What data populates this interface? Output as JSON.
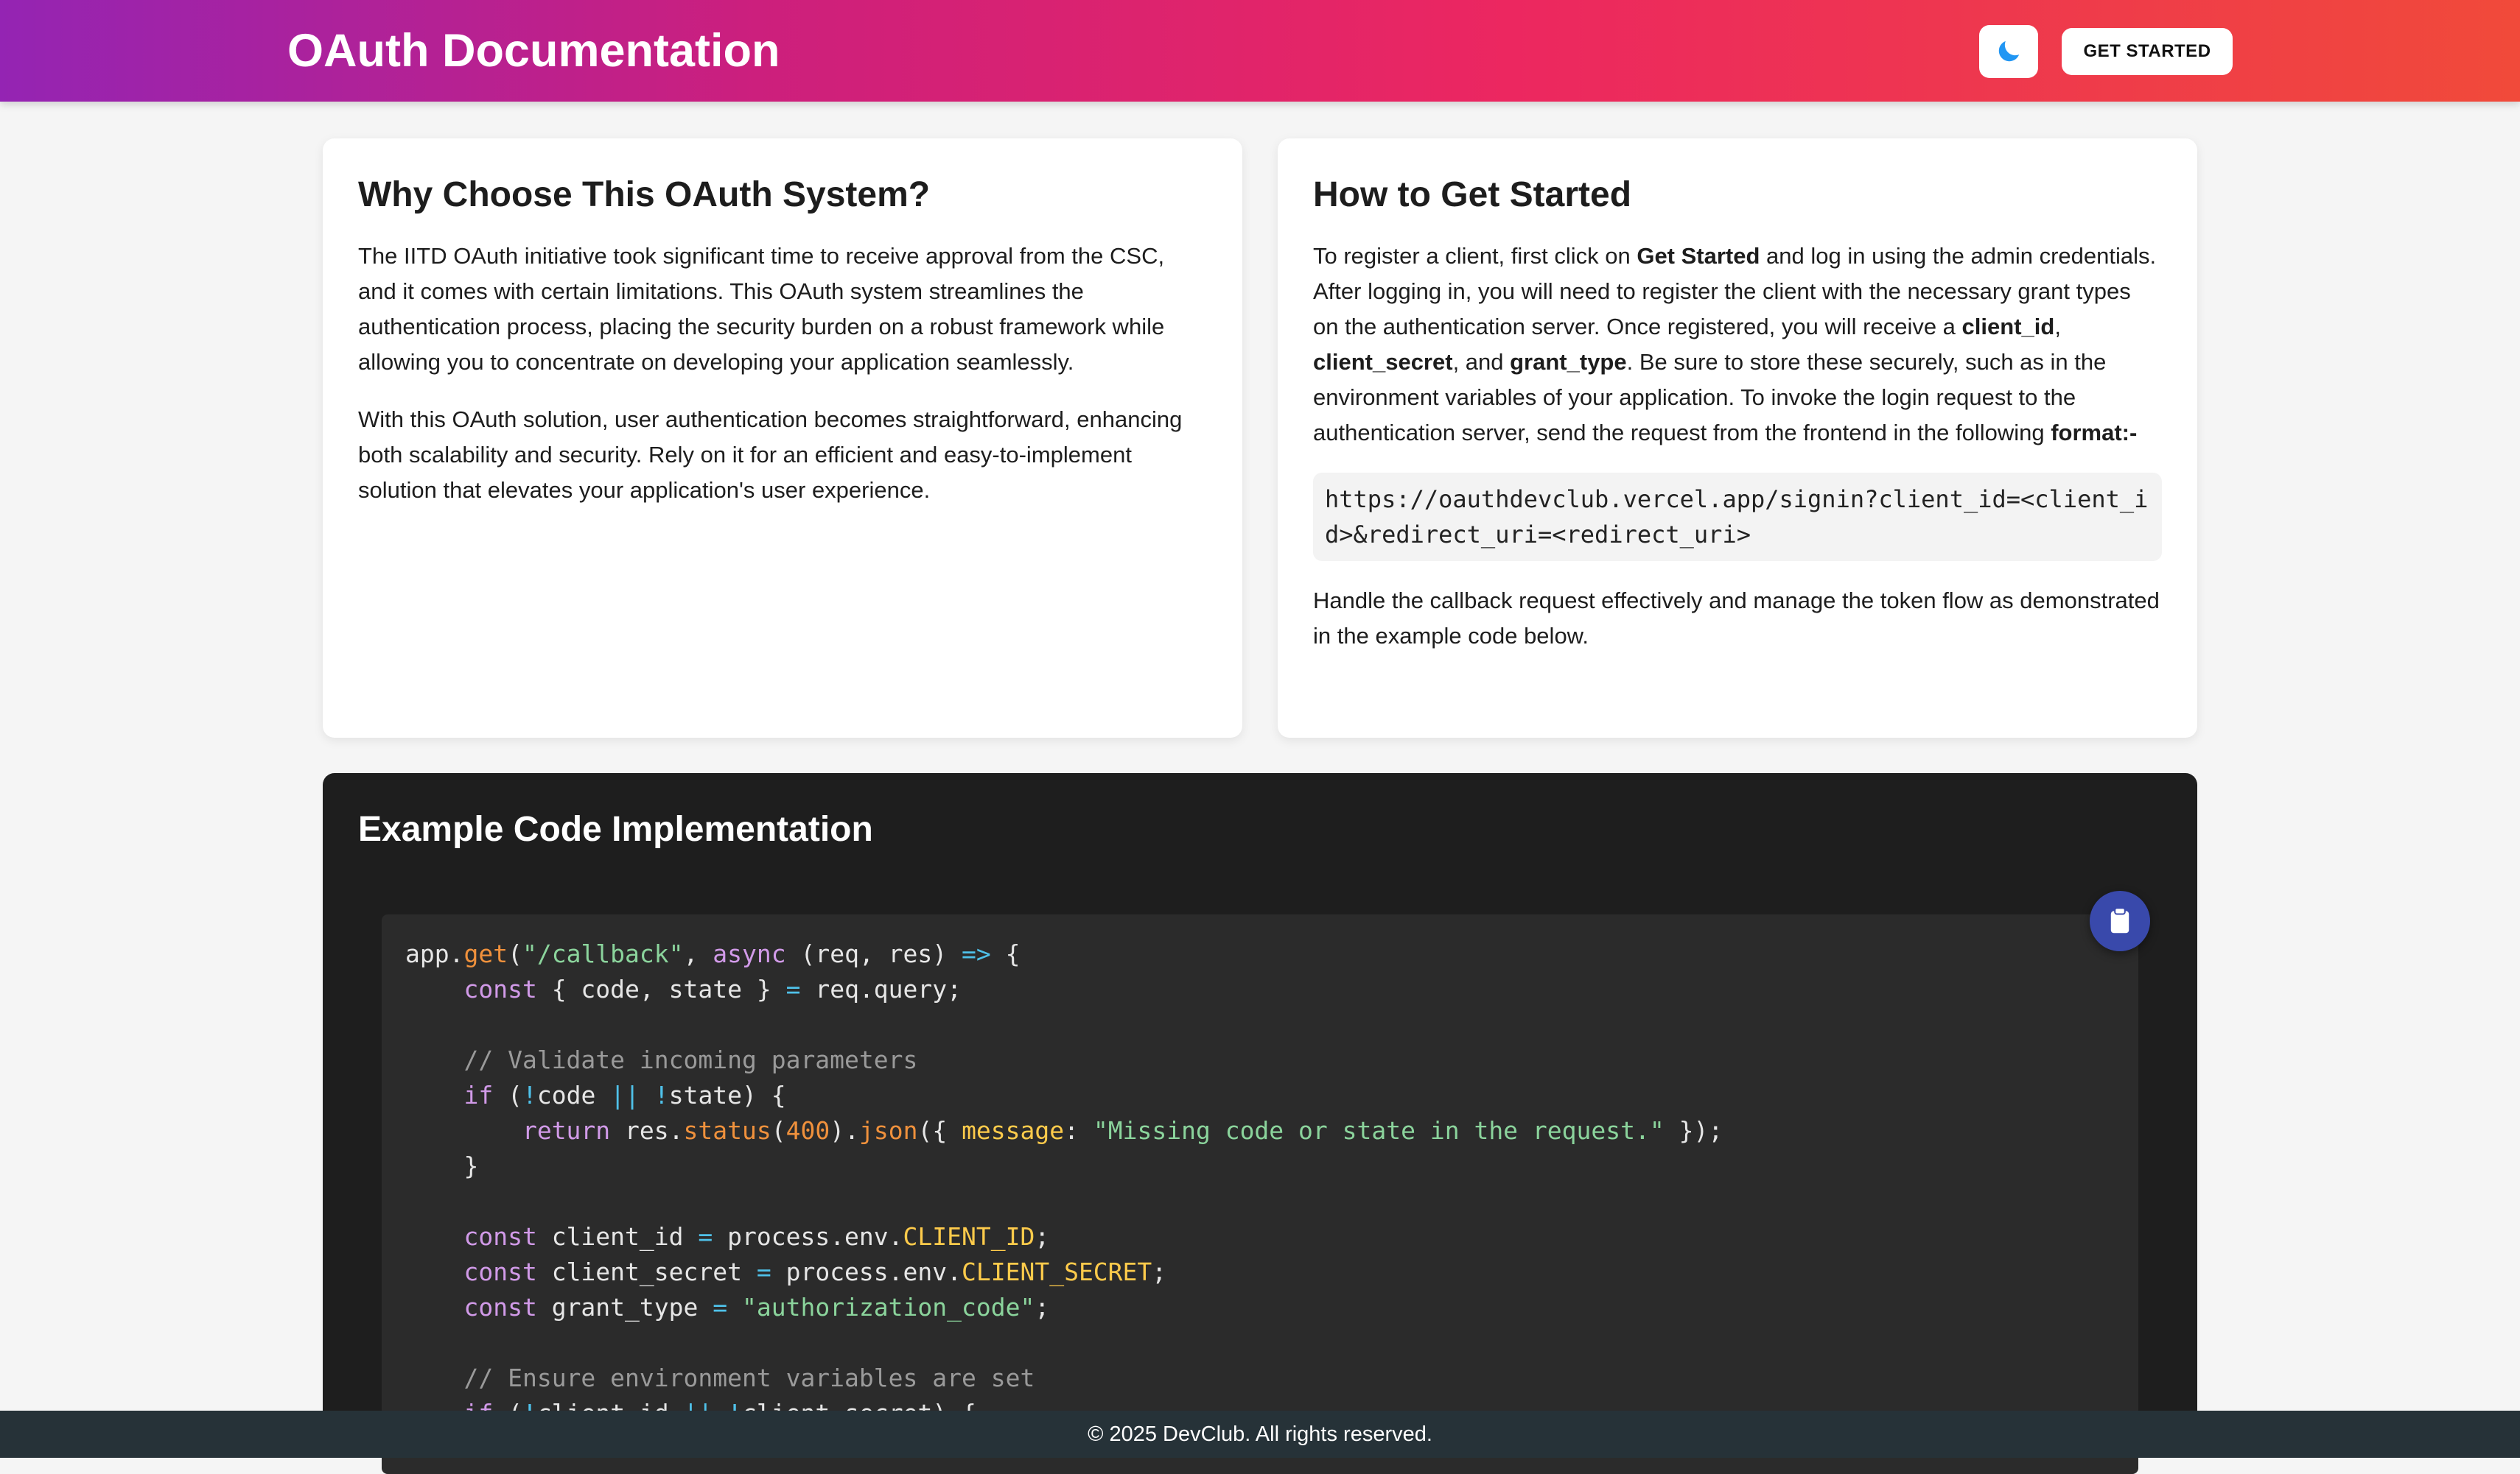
{
  "header": {
    "title": "OAuth Documentation",
    "theme_toggle_icon": "moon-icon",
    "get_started_label": "GET STARTED",
    "gradient": [
      "#9424b3",
      "#ec2760",
      "#f14a3a"
    ]
  },
  "why": {
    "title": "Why Choose This OAuth System?",
    "paragraph1": "The IITD OAuth initiative took significant time to receive approval from the CSC, and it comes with certain limitations. This OAuth system streamlines the authentication process, placing the security burden on a robust framework while allowing you to concentrate on developing your application seamlessly.",
    "paragraph2": "With this OAuth solution, user authentication becomes straightforward, enhancing both scalability and security. Rely on it for an efficient and easy-to-implement solution that elevates your application's user experience."
  },
  "how": {
    "title": "How to Get Started",
    "p1_a": "To register a client, first click on ",
    "p1_bold_get_started": "Get Started",
    "p1_b": " and log in using the admin credentials. After logging in, you will need to register the client with the necessary grant types on the authentication server. Once registered, you will receive a ",
    "p1_bold_client_id": "client_id",
    "p1_sep1": ", ",
    "p1_bold_client_secret": "client_secret",
    "p1_sep2": ", and ",
    "p1_bold_grant_type": "grant_type",
    "p1_c": ". Be sure to store these securely, such as in the environment variables of your application. To invoke the login request to the authentication server, send the request from the frontend in the following ",
    "p1_bold_format": "format:-",
    "url": "https://oauthdevclub.vercel.app/signin?client_id=<client_id>&redirect_uri=<redirect_uri>",
    "p2": "Handle the callback request effectively and manage the token flow as demonstrated in the example code below."
  },
  "code_section": {
    "title": "Example Code Implementation",
    "copy_icon": "clipboard-icon",
    "copy_button_color": "#3949ab",
    "lines": [
      "app.get(\"/callback\", async (req, res) => {",
      "    const { code, state } = req.query;",
      "",
      "    // Validate incoming parameters",
      "    if (!code || !state) {",
      "        return res.status(400).json({ message: \"Missing code or state in the request.\" });",
      "    }",
      "",
      "    const client_id = process.env.CLIENT_ID;",
      "    const client_secret = process.env.CLIENT_SECRET;",
      "    const grant_type = \"authorization_code\";",
      "",
      "    // Ensure environment variables are set",
      "    if (!client_id || !client_secret) {"
    ]
  },
  "footer": {
    "text": "© 2025 DevClub. All rights reserved."
  }
}
